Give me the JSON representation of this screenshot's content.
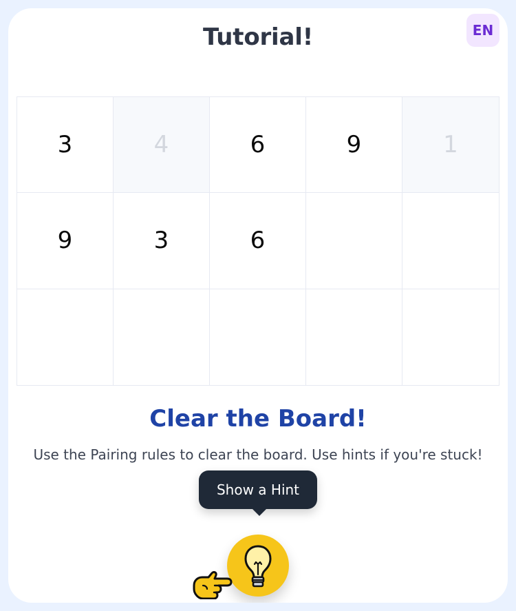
{
  "header": {
    "title": "Tutorial!",
    "language_button": "EN"
  },
  "board": {
    "rows": 3,
    "cols": 5,
    "cells": [
      {
        "value": "3",
        "cleared": false
      },
      {
        "value": "4",
        "cleared": true
      },
      {
        "value": "6",
        "cleared": false
      },
      {
        "value": "9",
        "cleared": false
      },
      {
        "value": "1",
        "cleared": true
      },
      {
        "value": "9",
        "cleared": false
      },
      {
        "value": "3",
        "cleared": false
      },
      {
        "value": "6",
        "cleared": false
      },
      {
        "value": "",
        "cleared": false
      },
      {
        "value": "",
        "cleared": false
      },
      {
        "value": "",
        "cleared": false
      },
      {
        "value": "",
        "cleared": false
      },
      {
        "value": "",
        "cleared": false
      },
      {
        "value": "",
        "cleared": false
      },
      {
        "value": "",
        "cleared": false
      }
    ]
  },
  "tutorial": {
    "headline": "Clear the Board!",
    "description": "Use the Pairing rules to clear the board. Use hints if you're stuck!",
    "tooltip": "Show a Hint"
  },
  "icons": {
    "hint": "lightbulb-icon",
    "pointer": "pointing-hand-icon"
  },
  "colors": {
    "background": "#eaf2ff",
    "card": "#ffffff",
    "title": "#2f3646",
    "headline": "#1f43a6",
    "language_bg": "#f2e6ff",
    "language_text": "#6b2bd3",
    "tooltip_bg": "#1f2937",
    "hint_button": "#f6c51a"
  }
}
